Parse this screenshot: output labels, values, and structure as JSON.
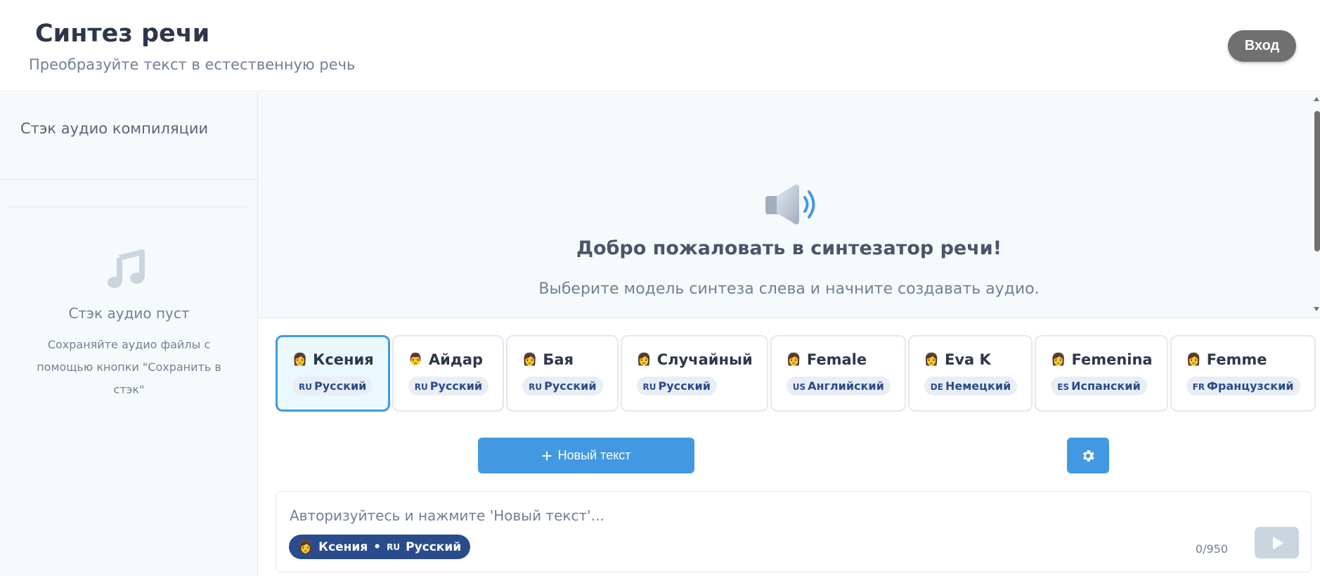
{
  "header": {
    "title": "Синтез речи",
    "subtitle": "Преобразуйте текст в естественную речь",
    "login_label": "Вход"
  },
  "sidebar": {
    "stack_title": "Стэк аудио компиляции",
    "empty_icon": "music-note-icon",
    "empty_title": "Стэк аудио пуст",
    "empty_desc": "Сохраняйте аудио файлы с помощью кнопки \"Сохранить в стэк\""
  },
  "welcome": {
    "icon": "speaker-icon",
    "title": "Добро пожаловать в синтезатор речи!",
    "desc": "Выберите модель синтеза слева и начните создавать аудио."
  },
  "voices": [
    {
      "emoji": "👩",
      "name": "Ксения",
      "code": "RU",
      "lang": "Русский",
      "selected": true
    },
    {
      "emoji": "👨",
      "name": "Айдар",
      "code": "RU",
      "lang": "Русский",
      "selected": false
    },
    {
      "emoji": "👩",
      "name": "Бая",
      "code": "RU",
      "lang": "Русский",
      "selected": false
    },
    {
      "emoji": "👩",
      "name": "Случайный",
      "code": "RU",
      "lang": "Русский",
      "selected": false
    },
    {
      "emoji": "👩",
      "name": "Female",
      "code": "US",
      "lang": "Английский",
      "selected": false
    },
    {
      "emoji": "👩",
      "name": "Eva K",
      "code": "DE",
      "lang": "Немецкий",
      "selected": false
    },
    {
      "emoji": "👩",
      "name": "Femenina",
      "code": "ES",
      "lang": "Испанский",
      "selected": false
    },
    {
      "emoji": "👩",
      "name": "Femme",
      "code": "FR",
      "lang": "Французский",
      "selected": false
    }
  ],
  "actions": {
    "new_text_label": "Новый текст",
    "settings_icon": "gear-icon"
  },
  "input": {
    "placeholder": "Авторизуйтесь и нажмите 'Новый текст'...",
    "chip": {
      "emoji": "👩",
      "name": "Ксения",
      "separator": "•",
      "code": "RU",
      "lang": "Русский"
    },
    "counter": "0/950",
    "play_icon": "play-icon"
  },
  "colors": {
    "accent": "#4299e1",
    "chip_bg": "#2b4c8c",
    "login_bg": "#707070"
  }
}
